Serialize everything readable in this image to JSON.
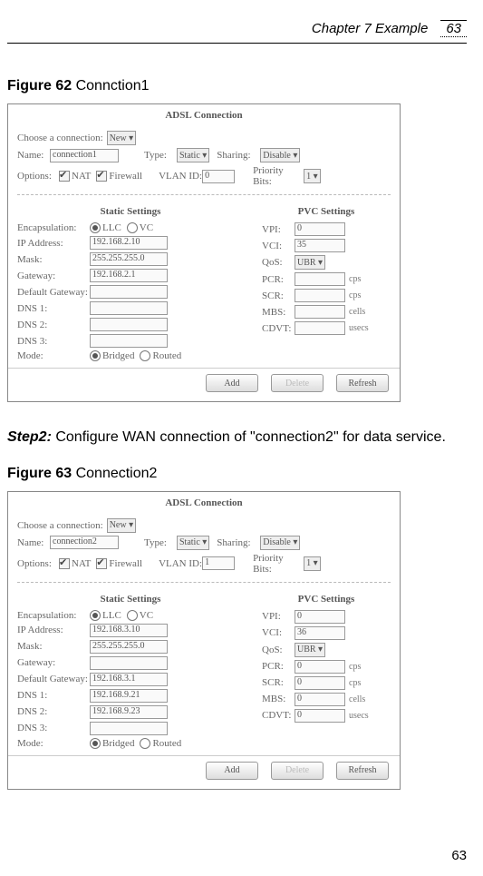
{
  "header": {
    "chapter": "Chapter 7 Example",
    "page": "63"
  },
  "fig1_caption_b": "Figure 62",
  "fig1_caption_t": " Connction1",
  "fig2_caption_b": "Figure 63",
  "fig2_caption_t": " Connection2",
  "step_b": "Step2:",
  "step_t": "  Configure  WAN  connection  of  \"connection2\"  for  data service.",
  "footer": "63",
  "panel1": {
    "title": "ADSL Connection",
    "choose": "Choose a connection:",
    "choose_sel": "New ▾",
    "name_l": "Name:",
    "name_v": "connection1",
    "type_l": "Type:",
    "type_v": "Static ▾",
    "sharing_l": "Sharing:",
    "sharing_v": "Disable ▾",
    "opt_l": "Options:",
    "nat": "NAT",
    "fire": "Firewall",
    "vlan_l": "VLAN ID:",
    "vlan_v": "0",
    "prio_l": "Priority Bits:",
    "prio_v": "1 ▾",
    "static_h": "Static Settings",
    "pvc_h": "PVC Settings",
    "encap_l": "Encapsulation:",
    "llc": "LLC",
    "vc": "VC",
    "ip_l": "IP Address:",
    "ip_v": "192.168.2.10",
    "mask_l": "Mask:",
    "mask_v": "255.255.255.0",
    "gw_l": "Gateway:",
    "gw_v": "192.168.2.1",
    "dgw_l": "Default Gateway:",
    "dgw_v": "",
    "dns1_l": "DNS 1:",
    "dns1_v": "",
    "dns2_l": "DNS 2:",
    "dns2_v": "",
    "dns3_l": "DNS 3:",
    "dns3_v": "",
    "mode_l": "Mode:",
    "bridged": "Bridged",
    "routed": "Routed",
    "vpi_l": "VPI:",
    "vpi_v": "0",
    "vci_l": "VCI:",
    "vci_v": "35",
    "qos_l": "QoS:",
    "qos_v": "UBR ▾",
    "pcr_l": "PCR:",
    "pcr_v": "",
    "pcr_u": "cps",
    "scr_l": "SCR:",
    "scr_v": "",
    "scr_u": "cps",
    "mbs_l": "MBS:",
    "mbs_v": "",
    "mbs_u": "cells",
    "cdvt_l": "CDVT:",
    "cdvt_v": "",
    "cdvt_u": "usecs",
    "btn_add": "Add",
    "btn_del": "Delete",
    "btn_ref": "Refresh"
  },
  "panel2": {
    "title": "ADSL Connection",
    "choose": "Choose a connection:",
    "choose_sel": "New ▾",
    "name_l": "Name:",
    "name_v": "connection2",
    "type_l": "Type:",
    "type_v": "Static ▾",
    "sharing_l": "Sharing:",
    "sharing_v": "Disable ▾",
    "opt_l": "Options:",
    "nat": "NAT",
    "fire": "Firewall",
    "vlan_l": "VLAN ID:",
    "vlan_v": "1",
    "prio_l": "Priority Bits:",
    "prio_v": "1 ▾",
    "static_h": "Static Settings",
    "pvc_h": "PVC Settings",
    "encap_l": "Encapsulation:",
    "llc": "LLC",
    "vc": "VC",
    "ip_l": "IP Address:",
    "ip_v": "192.168.3.10",
    "mask_l": "Mask:",
    "mask_v": "255.255.255.0",
    "gw_l": "Gateway:",
    "gw_v": "",
    "dgw_l": "Default Gateway:",
    "dgw_v": "192.168.3.1",
    "dns1_l": "DNS 1:",
    "dns1_v": "192.168.9.21",
    "dns2_l": "DNS 2:",
    "dns2_v": "192.168.9.23",
    "dns3_l": "DNS 3:",
    "dns3_v": "",
    "mode_l": "Mode:",
    "bridged": "Bridged",
    "routed": "Routed",
    "vpi_l": "VPI:",
    "vpi_v": "0",
    "vci_l": "VCI:",
    "vci_v": "36",
    "qos_l": "QoS:",
    "qos_v": "UBR ▾",
    "pcr_l": "PCR:",
    "pcr_v": "0",
    "pcr_u": "cps",
    "scr_l": "SCR:",
    "scr_v": "0",
    "scr_u": "cps",
    "mbs_l": "MBS:",
    "mbs_v": "0",
    "mbs_u": "cells",
    "cdvt_l": "CDVT:",
    "cdvt_v": "0",
    "cdvt_u": "usecs",
    "btn_add": "Add",
    "btn_del": "Delete",
    "btn_ref": "Refresh"
  }
}
